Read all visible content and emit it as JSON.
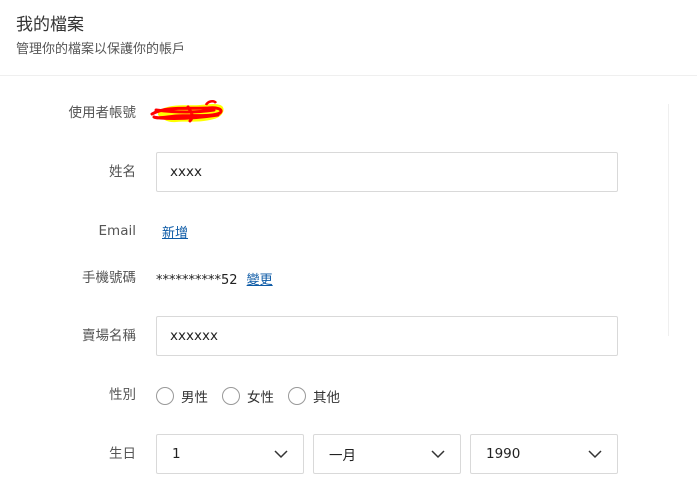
{
  "header": {
    "title": "我的檔案",
    "subtitle": "管理你的檔案以保護你的帳戶"
  },
  "form": {
    "username": {
      "label": "使用者帳號"
    },
    "name": {
      "label": "姓名",
      "value": "xxxx"
    },
    "email": {
      "label": "Email",
      "link": "新增"
    },
    "phone": {
      "label": "手機號碼",
      "value": "**********52",
      "link": "變更"
    },
    "shop_name": {
      "label": "賣場名稱",
      "value": "xxxxxx"
    },
    "gender": {
      "label": "性別",
      "options": [
        "男性",
        "女性",
        "其他"
      ],
      "selected": null
    },
    "birthday": {
      "label": "生日",
      "day": "1",
      "month": "一月",
      "year": "1990"
    }
  },
  "colors": {
    "link": "#0c5aa6",
    "redaction_red": "#ff0000",
    "redaction_yellow": "#ffff00"
  }
}
